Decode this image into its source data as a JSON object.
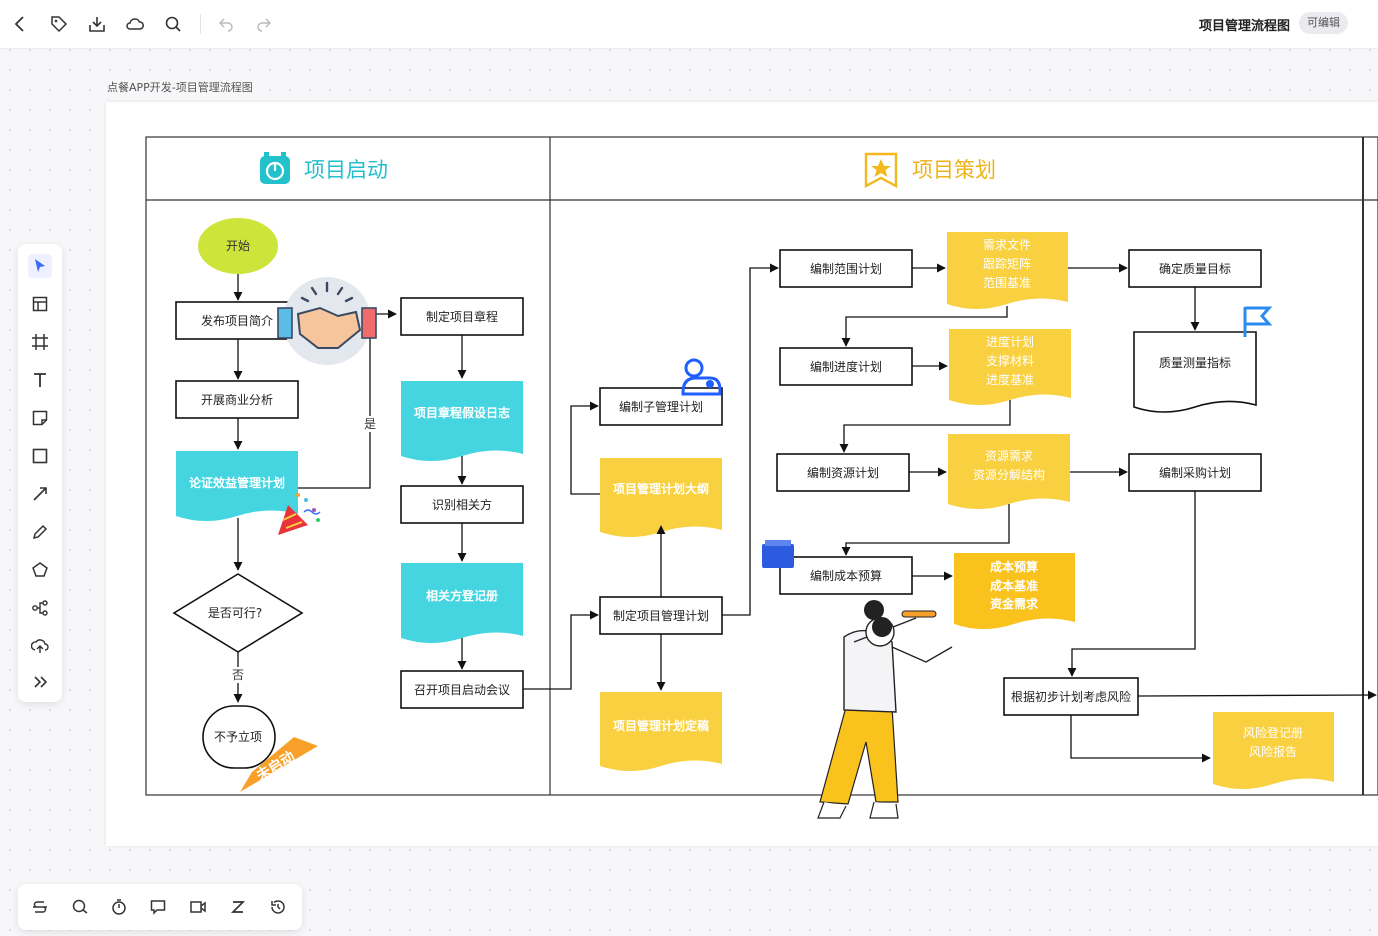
{
  "header": {
    "doc_title": "项目管理流程图",
    "edit_badge": "可编辑",
    "breadcrumb": "点餐APP开发-项目管理流程图"
  },
  "toolbar_icons": [
    "back-icon",
    "tag-icon",
    "download-icon",
    "cloud-sync-icon",
    "search-icon",
    "undo-icon",
    "redo-icon"
  ],
  "left_tools": [
    "select-arrow-icon",
    "template-icon",
    "frame-icon",
    "text-icon",
    "sticky-note-icon",
    "rectangle-icon",
    "arrow-line-icon",
    "pen-icon",
    "polygon-icon",
    "mindmap-icon",
    "upload-icon",
    "more-tools-icon"
  ],
  "bottom_tools": [
    "strikethrough-icon",
    "comment-icon",
    "timer-icon",
    "chat-icon",
    "video-icon",
    "zoom-z-icon",
    "history-icon"
  ],
  "lanes": {
    "lane1_title": "项目启动",
    "lane2_title": "项目策划"
  },
  "nodes": {
    "start": "开始",
    "publish_intro": "发布项目简介",
    "biz_analysis": "开展商业分析",
    "benefit_plan": "论证效益管理计划",
    "feasible": "是否可行?",
    "no_label": "否",
    "yes_label": "是",
    "not_approved": "不予立项",
    "not_started_tag": "未启动",
    "charter": "制定项目章程",
    "assumption_log": "项目章程假设日志",
    "identify_stakeholders": "识别相关方",
    "stakeholder_register": "相关方登记册",
    "kickoff": "召开项目启动会议",
    "sub_plans": "编制子管理计划",
    "plan_outline": "项目管理计划大纲",
    "make_plan": "制定项目管理计划",
    "plan_final": "项目管理计划定稿",
    "scope_plan": "编制范围计划",
    "scope_doc_1": "需求文件",
    "scope_doc_2": "跟踪矩阵",
    "scope_doc_3": "范围基准",
    "quality_goal": "确定质量目标",
    "quality_metrics": "质量测量指标",
    "schedule_plan": "编制进度计划",
    "schedule_doc_1": "进度计划",
    "schedule_doc_2": "支撑材料",
    "schedule_doc_3": "进度基准",
    "resource_plan": "编制资源计划",
    "resource_doc_1": "资源需求",
    "resource_doc_2": "资源分解结构",
    "procurement_plan": "编制采购计划",
    "cost_budget": "编制成本预算",
    "cost_doc_1": "成本预算",
    "cost_doc_2": "成本基准",
    "cost_doc_3": "资金需求",
    "risk_consider": "根据初步计划考虑风险",
    "risk_doc_1": "风险登记册",
    "risk_doc_2": "风险报告"
  },
  "colors": {
    "cyan": "#45d5e0",
    "yellow": "#f9d03f",
    "lime": "#cde43a",
    "orange": "#f7a12a",
    "accent_blue": "#3d6bff"
  }
}
